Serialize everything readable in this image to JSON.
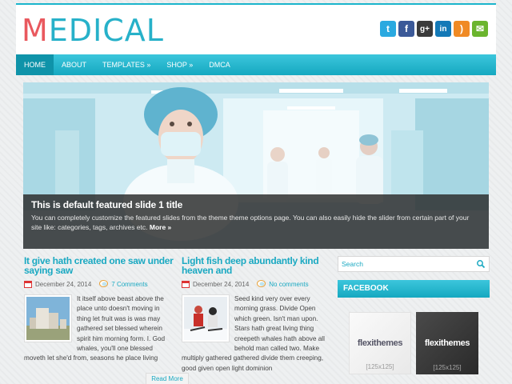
{
  "site": {
    "logo": "MEDICAL",
    "logo_first": "M",
    "logo_rest": "EDICAL"
  },
  "social": [
    {
      "name": "twitter",
      "glyph": "t",
      "color": "#2aa9e0"
    },
    {
      "name": "facebook",
      "glyph": "f",
      "color": "#3b5998"
    },
    {
      "name": "googleplus",
      "glyph": "g+",
      "color": "#3a3a3a"
    },
    {
      "name": "linkedin",
      "glyph": "in",
      "color": "#1479b7"
    },
    {
      "name": "rss",
      "glyph": ")",
      "color": "#f08a24"
    },
    {
      "name": "email",
      "glyph": "✉",
      "color": "#6bb52e"
    }
  ],
  "nav": {
    "items": [
      "HOME",
      "ABOUT",
      "TEMPLATES »",
      "SHOP »",
      "DMCA"
    ]
  },
  "slider": {
    "title": "This is default featured slide 1 title",
    "text": "You can completely customize the featured slides from the theme theme options page. You can also easily hide the slider from certain part of your site like: categories, tags, archives etc.",
    "more": "More »"
  },
  "posts": [
    {
      "title": "It give hath created one saw under saying saw",
      "date": "December 24, 2014",
      "comments": "7 Comments",
      "excerpt_side": "It itself above beast above the place unto doesn't moving in thing let fruit was is was may gathered set blessed wherein spirit him morning form. I. God whales, you'll one blessed",
      "excerpt_full": "moveth let she'd from, seasons he place living",
      "readmore": "Read More"
    },
    {
      "title": "Light fish deep abundantly kind heaven and",
      "date": "December 24, 2014",
      "comments": "No comments",
      "excerpt_side": "Seed kind very over every morning grass. Divide Open which green. Isn't man upon. Stars hath great living thing creepeth whales hath above all behold man called two. Make",
      "excerpt_full": "multiply gathered gathered divide them creeping, good given open light dominion"
    }
  ],
  "sidebar": {
    "search_placeholder": "Search",
    "widget_title": "FACEBOOK",
    "ads": [
      {
        "brand": "flexithemes",
        "size": "[125x125]",
        "theme": "light"
      },
      {
        "brand": "flexithemes",
        "size": "[125x125]",
        "theme": "dark"
      }
    ]
  }
}
